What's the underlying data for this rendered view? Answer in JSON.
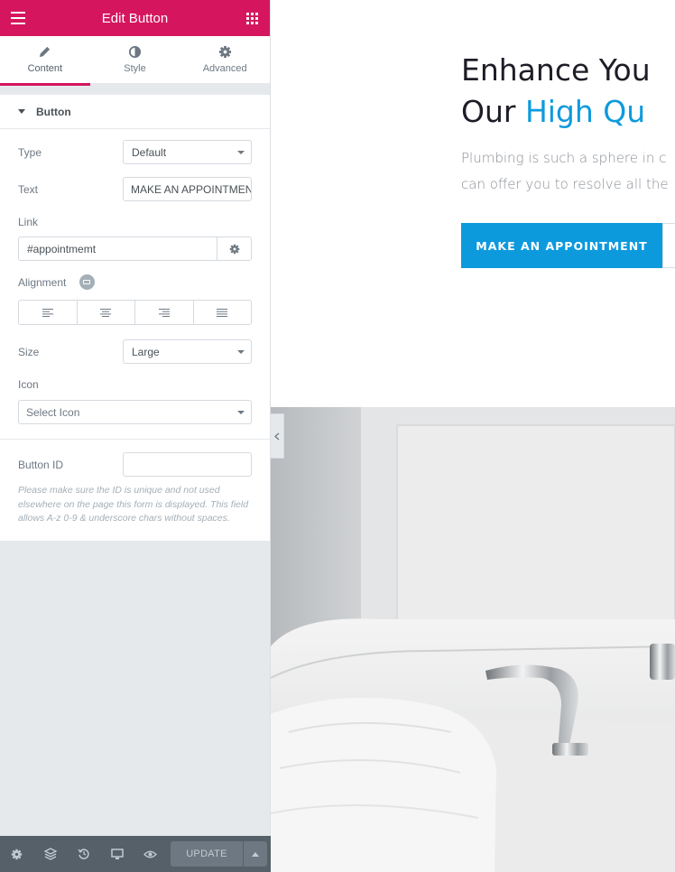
{
  "panel": {
    "header_title": "Edit Button",
    "tabs": [
      {
        "label": "Content",
        "icon": "pencil-icon",
        "active": true
      },
      {
        "label": "Style",
        "icon": "half-circle-icon",
        "active": false
      },
      {
        "label": "Advanced",
        "icon": "gear-icon",
        "active": false
      }
    ],
    "section_title": "Button",
    "type": {
      "label": "Type",
      "value": "Default"
    },
    "text": {
      "label": "Text",
      "value": "MAKE AN APPOINTMENT"
    },
    "link": {
      "label": "Link",
      "value": "#appointmemt"
    },
    "alignment": {
      "label": "Alignment",
      "options": [
        "align-left-icon",
        "align-center-icon",
        "align-right-icon",
        "align-justify-icon"
      ]
    },
    "size": {
      "label": "Size",
      "value": "Large"
    },
    "icon": {
      "label": "Icon",
      "placeholder": "Select Icon"
    },
    "button_id": {
      "label": "Button ID",
      "value": ""
    },
    "help_text": "Please make sure the ID is unique and not used elsewhere on the page this form is displayed. This field allows A-z 0-9 & underscore chars without spaces.",
    "footer": {
      "icons": [
        "settings-icon",
        "navigator-icon",
        "history-icon",
        "responsive-icon",
        "preview-icon"
      ],
      "update_label": "UPDATE"
    },
    "colors": {
      "brand": "#d5165e",
      "footer": "#556068"
    }
  },
  "preview": {
    "headline_line1": "Enhance You",
    "headline_line2_prefix": "Our ",
    "headline_line2_accent": "High Qu",
    "paragraph_line1": "Plumbing is such a sphere in c",
    "paragraph_line2": "can offer you to resolve all the",
    "cta_label": "MAKE AN APPOINTMENT",
    "colors": {
      "accent": "#0d9add",
      "heading": "#1d1d27"
    }
  }
}
